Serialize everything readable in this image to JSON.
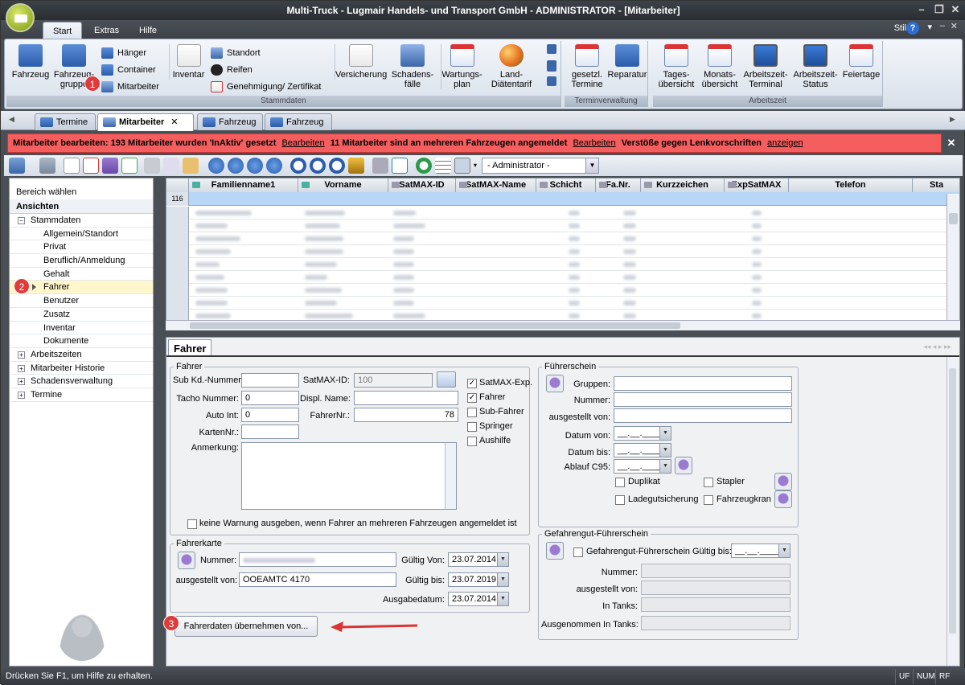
{
  "window": {
    "title": "Multi-Truck - Lugmair Handels- und Transport GmbH - ADMINISTRATOR - [Mitarbeiter]"
  },
  "menu": {
    "tabs": [
      "Start",
      "Extras",
      "Hilfe"
    ],
    "style_label": "Stil"
  },
  "ribbon": {
    "groups": [
      "Stammdaten",
      "Terminverwaltung",
      "Arbeitszeit"
    ],
    "stammdaten": {
      "fahrzeug": "Fahrzeug",
      "fahrzeuggruppe": "Fahrzeug-gruppe",
      "haenger": "Hänger",
      "container": "Container",
      "mitarbeiter": "Mitarbeiter",
      "inventar": "Inventar",
      "standort": "Standort",
      "reifen": "Reifen",
      "genehmigung": "Genehmigung/ Zertifikat",
      "versicherung": "Versicherung",
      "schadensfaelle": "Schadens-fälle",
      "wartungsplan": "Wartungs-plan",
      "land_diaetentarif": "Land-Diätentarif"
    },
    "terminverwaltung": {
      "gesetzl_termine": "gesetzl. Termine",
      "reparatur": "Reparatur"
    },
    "arbeitszeit": {
      "tagesuebersicht": "Tages-übersicht",
      "monatsuebersicht": "Monats-übersicht",
      "arbeitszeit_terminal": "Arbeitszeit-Terminal",
      "arbeitszeit_status": "Arbeitszeit-Status",
      "feiertage": "Feiertage"
    }
  },
  "doc_tabs": [
    "Termine",
    "Mitarbeiter",
    "Fahrzeug",
    "Fahrzeug"
  ],
  "notice": {
    "text1": "Mitarbeiter bearbeiten: 193 Mitarbeiter wurden 'InAktiv' gesetzt",
    "link1": "Bearbeiten",
    "text2": "11 Mitarbeiter sind an mehreren Fahrzeugen angemeldet",
    "link2": "Bearbeiten",
    "text3": "Verstöße gegen Lenkvorschriften",
    "link3": "anzeigen"
  },
  "toolbar": {
    "user_select": "- Administrator -"
  },
  "left_panel": {
    "header": "Bereich wählen",
    "section": "Ansichten",
    "tree": [
      {
        "label": "Stammdaten",
        "expanded": true
      },
      {
        "label": "Allgemein/Standort",
        "child": true
      },
      {
        "label": "Privat",
        "child": true
      },
      {
        "label": "Beruflich/Anmeldung",
        "child": true
      },
      {
        "label": "Gehalt",
        "child": true
      },
      {
        "label": "Fahrer",
        "child": true,
        "selected": true
      },
      {
        "label": "Benutzer",
        "child": true
      },
      {
        "label": "Zusatz",
        "child": true
      },
      {
        "label": "Inventar",
        "child": true
      },
      {
        "label": "Dokumente",
        "child": true
      },
      {
        "label": "Arbeitszeiten",
        "expanded": false
      },
      {
        "label": "Mitarbeiter Historie",
        "expanded": false
      },
      {
        "label": "Schadensverwaltung",
        "expanded": false
      },
      {
        "label": "Termine",
        "expanded": false
      }
    ]
  },
  "grid": {
    "columns": [
      "Familienname1",
      "Vorname",
      "SatMAX-ID",
      "SatMAX-Name",
      "Schicht",
      "Fa.Nr.",
      "Kurzzeichen",
      "ExpSatMAX",
      "Telefon",
      "Sta"
    ],
    "filter_row_number": "116"
  },
  "fahrer_panel": {
    "title": "Fahrer",
    "fahrer_group": {
      "legend": "Fahrer",
      "sub_kd_nummer_label": "Sub Kd.-Nummer:",
      "sub_kd_nummer": "",
      "tacho_label": "Tacho Nummer:",
      "tacho": "0",
      "auto_int_label": "Auto Int:",
      "auto_int": "0",
      "kartennr_label": "KartenNr.:",
      "kartennr": "",
      "anmerkung_label": "Anmerkung:",
      "satmax_id_label": "SatMAX-ID:",
      "satmax_id": "100",
      "displ_name_label": "Displ. Name:",
      "displ_name": "",
      "fahrernr_label": "FahrerNr.:",
      "fahrernr": "78",
      "checks": [
        {
          "label": "SatMAX-Exp.",
          "checked": true
        },
        {
          "label": "Fahrer",
          "checked": true
        },
        {
          "label": "Sub-Fahrer",
          "checked": false
        },
        {
          "label": "Springer",
          "checked": false
        },
        {
          "label": "Aushilfe",
          "checked": false
        }
      ],
      "warning_label": "keine Warnung ausgeben, wenn Fahrer an mehreren Fahrzeugen angemeldet ist",
      "warning_checked": false
    },
    "fahrerkarte": {
      "legend": "Fahrerkarte",
      "nummer_label": "Nummer:",
      "ausgestellt_label": "ausgestellt von:",
      "ausgestellt": "OOEAMTC 4170",
      "gueltig_von_label": "Gültig Von:",
      "gueltig_von": "23.07.2014",
      "gueltig_bis_label": "Gültig bis:",
      "gueltig_bis": "23.07.2019",
      "ausgabedatum_label": "Ausgabedatum:",
      "ausgabedatum": "23.07.2014"
    },
    "uebernehmen_button": "Fahrerdaten übernehmen von...",
    "fuehrerschein": {
      "legend": "Führerschein",
      "gruppen_label": "Gruppen:",
      "nummer_label": "Nummer:",
      "ausgestellt_label": "ausgestellt von:",
      "datum_von_label": "Datum von:",
      "datum_bis_label": "Datum bis:",
      "ablauf_label": "Ablauf C95:",
      "date_placeholder": "__.__.____",
      "checks": [
        {
          "label": "Duplikat",
          "checked": false
        },
        {
          "label": "Stapler",
          "checked": false
        },
        {
          "label": "Ladegutsicherung",
          "checked": false
        },
        {
          "label": "Fahrzeugkran",
          "checked": false
        }
      ]
    },
    "gefahrengut": {
      "legend": "Gefahrengut-Führerschein",
      "check_label": "Gefahrengut-Führerschein",
      "gueltig_bis_label": "Gültig bis:",
      "gueltig_bis": "__.__.____",
      "nummer_label": "Nummer:",
      "ausgestellt_label": "ausgestellt von:",
      "in_tanks_label": "In Tanks:",
      "ausgenommen_label": "Ausgenommen In Tanks:"
    }
  },
  "badges": [
    "1",
    "2",
    "3"
  ],
  "status": {
    "text": "Drücken Sie F1, um Hilfe zu erhalten.",
    "ind1": "UF",
    "ind2": "NUM",
    "ind3": "RF"
  }
}
